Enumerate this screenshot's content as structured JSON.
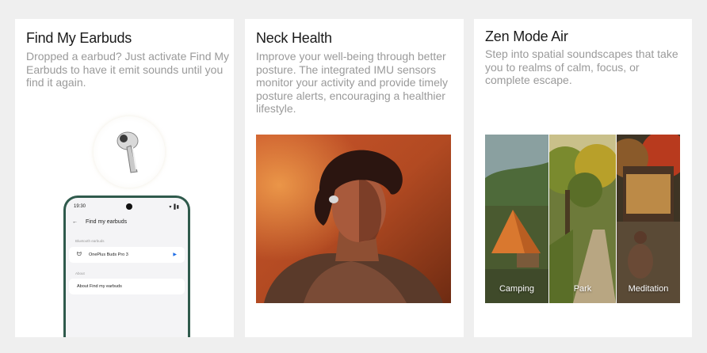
{
  "cards": [
    {
      "title": "Find My Earbuds",
      "description": "Dropped a earbud? Just activate Find My Earbuds to have it emit sounds until you find it again.",
      "phone": {
        "time": "19:30",
        "header": "Find my earbuds",
        "section_bluetooth": "Bluetooth earbuds",
        "device": "OnePlus Buds Pro 3",
        "section_about": "About",
        "about_item": "About Find my earbuds"
      }
    },
    {
      "title": "Neck Health",
      "description": "Improve your well-being through better posture. The integrated IMU sensors monitor your activity and provide timely posture alerts, encouraging a healthier lifestyle."
    },
    {
      "title": "Zen Mode Air",
      "description": "Step into spatial soundscapes that take you to realms of calm, focus, or complete escape.",
      "panels": [
        "Camping",
        "Park",
        "Meditation"
      ]
    }
  ],
  "colors": {
    "phone_frame": "#2f5a4c",
    "play_accent": "#1f6ee6",
    "title": "#1a1a1a",
    "description": "#9a9a9a"
  },
  "icons": [
    "earbud-icon",
    "back-arrow-icon",
    "earbud-small-icon",
    "play-icon",
    "camera-icon",
    "signal-icon"
  ]
}
